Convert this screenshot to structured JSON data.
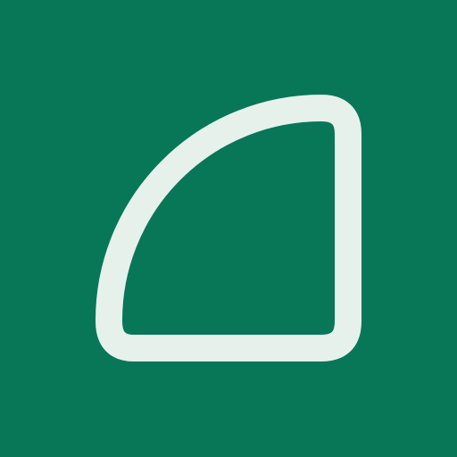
{
  "icon": {
    "name": "quarter-circle-icon",
    "background_color": "#077757",
    "stroke_color": "#E6F1EC"
  }
}
